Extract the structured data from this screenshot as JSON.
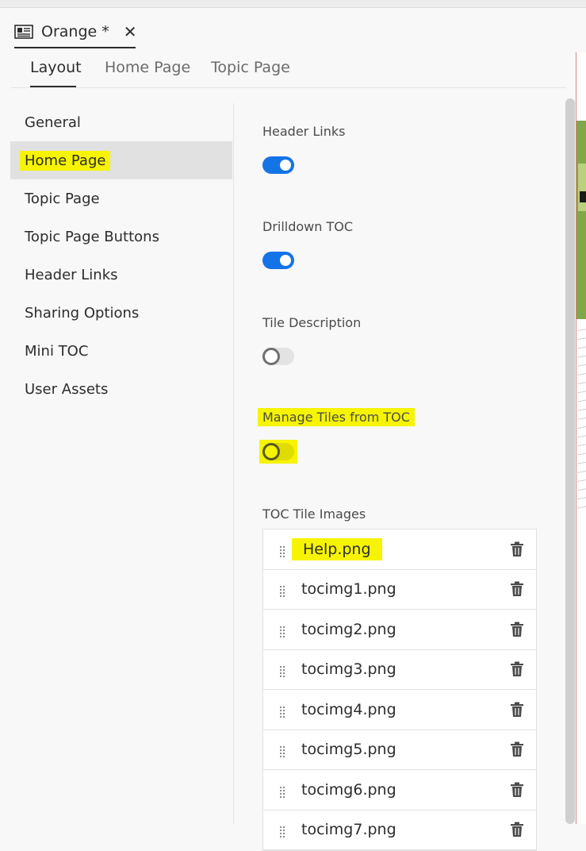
{
  "doc_tab": {
    "title": "Orange *",
    "close": "✕"
  },
  "tabs": [
    {
      "label": "Layout"
    },
    {
      "label": "Home Page"
    },
    {
      "label": "Topic Page"
    }
  ],
  "nav": {
    "items": [
      {
        "label": "General"
      },
      {
        "label": "Home Page"
      },
      {
        "label": "Topic Page"
      },
      {
        "label": "Topic Page Buttons"
      },
      {
        "label": "Header Links"
      },
      {
        "label": "Sharing Options"
      },
      {
        "label": "Mini TOC"
      },
      {
        "label": "User Assets"
      }
    ],
    "selected_index": 1
  },
  "settings": {
    "header_links": {
      "label": "Header Links",
      "on": true
    },
    "drilldown_toc": {
      "label": "Drilldown TOC",
      "on": true
    },
    "tile_description": {
      "label": "Tile Description",
      "on": false
    },
    "manage_tiles": {
      "label": "Manage Tiles from TOC",
      "on": false
    },
    "toc_tile_images": {
      "label": "TOC Tile Images"
    }
  },
  "tile_images": [
    "Help.png",
    "tocimg1.png",
    "tocimg2.png",
    "tocimg3.png",
    "tocimg4.png",
    "tocimg5.png",
    "tocimg6.png",
    "tocimg7.png"
  ],
  "colors": {
    "accent": "#1473e6",
    "highlight": "#f6f400",
    "selected_nav": "#e1e1e1"
  }
}
